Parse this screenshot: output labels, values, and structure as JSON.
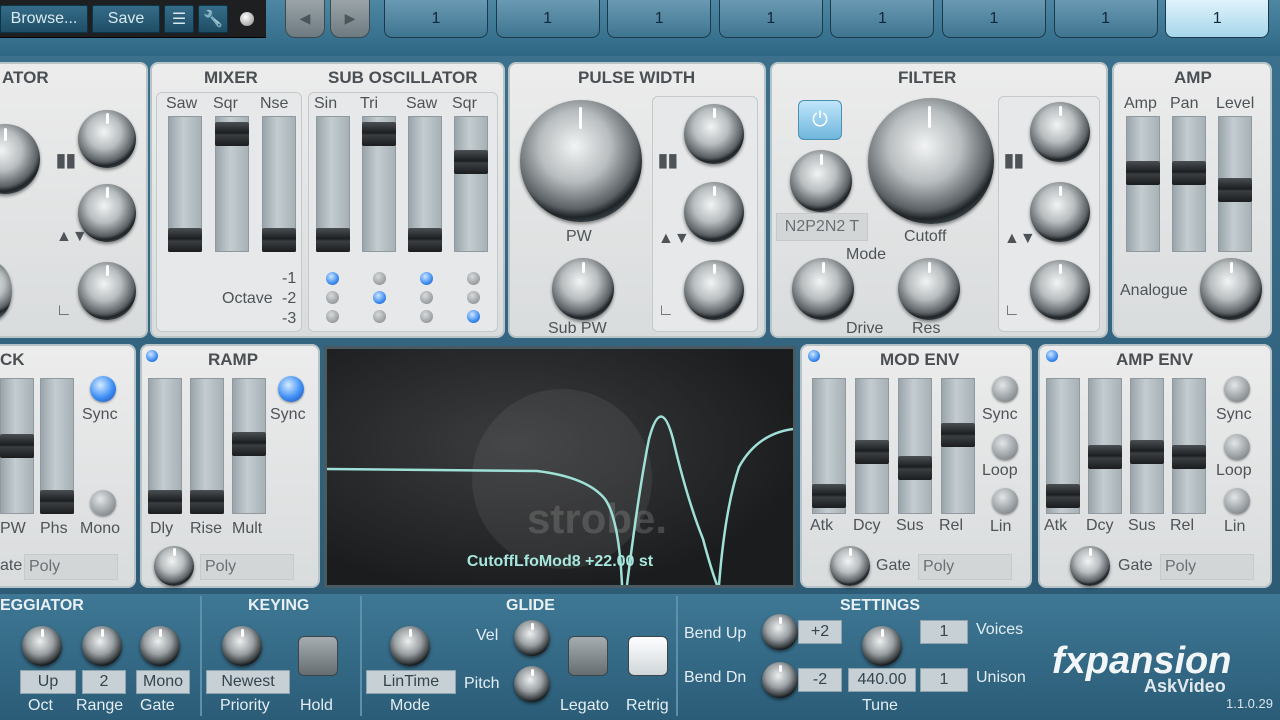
{
  "toolbar": {
    "browse": "Browse...",
    "save": "Save",
    "list_icon": "list-icon",
    "settings_icon": "wrench-icon"
  },
  "sequencer": {
    "steps": [
      "1",
      "1",
      "1",
      "1",
      "1",
      "1",
      "1",
      "1"
    ],
    "active_step": 8
  },
  "oscillator": {
    "title": "ATOR"
  },
  "mixer": {
    "title": "MIXER",
    "channels": [
      {
        "label": "Saw",
        "level": 0.0
      },
      {
        "label": "Sqr",
        "level": 0.95
      },
      {
        "label": "Nse",
        "level": 0.0
      }
    ]
  },
  "sub_osc": {
    "title": "SUB OSCILLATOR",
    "channels": [
      {
        "label": "Sin",
        "level": 0.0
      },
      {
        "label": "Tri",
        "level": 0.95
      },
      {
        "label": "Saw",
        "level": 0.0
      },
      {
        "label": "Sqr",
        "level": 0.7
      }
    ],
    "octave_label": "Octave",
    "octaves": [
      "-1",
      "-2",
      "-3"
    ],
    "octave_selection": [
      1,
      2,
      1,
      3
    ]
  },
  "pulse_width": {
    "title": "PULSE WIDTH",
    "pw": "PW",
    "sub_pw": "Sub PW"
  },
  "filter": {
    "title": "FILTER",
    "mode_value": "N2P2N2 T",
    "mode": "Mode",
    "cutoff": "Cutoff",
    "drive": "Drive",
    "res": "Res"
  },
  "amp": {
    "title": "AMP",
    "faders": [
      {
        "label": "Amp",
        "level": 0.6
      },
      {
        "label": "Pan",
        "level": 0.6
      },
      {
        "label": "Level",
        "level": 0.45
      }
    ],
    "analogue": "Analogue"
  },
  "lfo_track": {
    "title": "CK",
    "sync": "Sync",
    "pw": "PW",
    "phs": "Phs",
    "mono": "Mono",
    "gate": "ate",
    "gate_value": "Poly"
  },
  "ramp": {
    "title": "RAMP",
    "sync": "Sync",
    "dly": "Dly",
    "rise": "Rise",
    "mult": "Mult",
    "gate_value": "Poly"
  },
  "display": {
    "readout": "CutoffLfoMod8 +22.00 st",
    "logo": "strobe."
  },
  "mod_env": {
    "title": "MOD ENV",
    "faders": [
      {
        "label": "Atk",
        "level": 0.05
      },
      {
        "label": "Dcy",
        "level": 0.45
      },
      {
        "label": "Sus",
        "level": 0.3
      },
      {
        "label": "Rel",
        "level": 0.6
      }
    ],
    "sync": "Sync",
    "loop": "Loop",
    "lin": "Lin",
    "gate": "Gate",
    "gate_value": "Poly"
  },
  "amp_env": {
    "title": "AMP ENV",
    "faders": [
      {
        "label": "Atk",
        "level": 0.05
      },
      {
        "label": "Dcy",
        "level": 0.4
      },
      {
        "label": "Sus",
        "level": 0.45
      },
      {
        "label": "Rel",
        "level": 0.4
      }
    ],
    "sync": "Sync",
    "loop": "Loop",
    "lin": "Lin",
    "gate": "Gate",
    "gate_value": "Poly"
  },
  "arpeggiator": {
    "title": "EGGIATOR",
    "oct_value": "Up",
    "oct": "Oct",
    "range_value": "2",
    "range": "Range",
    "gate_value": "Mono",
    "gate": "Gate"
  },
  "keying": {
    "title": "KEYING",
    "priority_value": "Newest",
    "priority": "Priority",
    "hold": "Hold",
    "mode_value": "LinTime",
    "mode": "Mode"
  },
  "glide": {
    "title": "GLIDE",
    "vel": "Vel",
    "pitch": "Pitch",
    "legato": "Legato",
    "retrig": "Retrig"
  },
  "settings": {
    "title": "SETTINGS",
    "bend_up": "Bend Up",
    "bend_up_value": "+2",
    "bend_dn": "Bend Dn",
    "bend_dn_value": "-2",
    "voices_value": "1",
    "voices": "Voices",
    "tune_value": "440.00",
    "tune": "Tune",
    "unison_value": "1",
    "unison": "Unison"
  },
  "brand": {
    "logo": "fxpansion",
    "watermark": "AskVideo",
    "version": "1.1.0.29"
  }
}
